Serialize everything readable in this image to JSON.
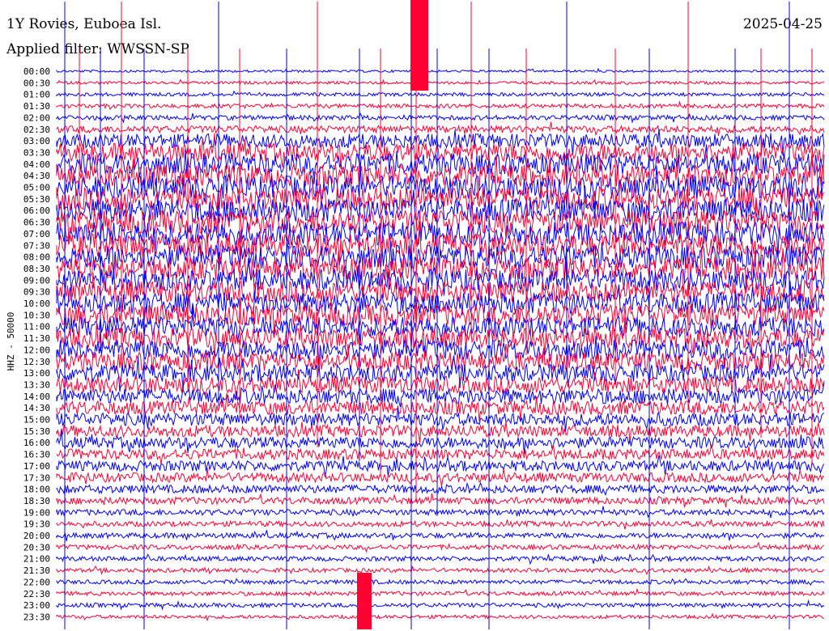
{
  "header": {
    "title": "1Y Rovies, Euboea Isl.",
    "date": "2025-04-25",
    "filter": "Applied filter: WWSSN-SP"
  },
  "chart_data": {
    "type": "line",
    "subtype": "helicorder",
    "ylabel": "HHZ - 50000",
    "colors": [
      "#0000ff",
      "#ff0033"
    ],
    "grid": false,
    "legend": "none",
    "rows": [
      {
        "label": "00:00",
        "amp": 0.2
      },
      {
        "label": "00:30",
        "amp": 0.25
      },
      {
        "label": "01:00",
        "amp": 0.3
      },
      {
        "label": "01:30",
        "amp": 0.35
      },
      {
        "label": "02:00",
        "amp": 0.4
      },
      {
        "label": "02:30",
        "amp": 0.6
      },
      {
        "label": "03:00",
        "amp": 1.2
      },
      {
        "label": "03:30",
        "amp": 1.6
      },
      {
        "label": "04:00",
        "amp": 1.8
      },
      {
        "label": "04:30",
        "amp": 1.9
      },
      {
        "label": "05:00",
        "amp": 2.0
      },
      {
        "label": "05:30",
        "amp": 2.0
      },
      {
        "label": "06:00",
        "amp": 2.0
      },
      {
        "label": "06:30",
        "amp": 2.0
      },
      {
        "label": "07:00",
        "amp": 2.0
      },
      {
        "label": "07:30",
        "amp": 2.0
      },
      {
        "label": "08:00",
        "amp": 2.0
      },
      {
        "label": "08:30",
        "amp": 2.0
      },
      {
        "label": "09:00",
        "amp": 1.9
      },
      {
        "label": "09:30",
        "amp": 1.8
      },
      {
        "label": "10:00",
        "amp": 1.8
      },
      {
        "label": "10:30",
        "amp": 1.8
      },
      {
        "label": "11:00",
        "amp": 1.7
      },
      {
        "label": "11:30",
        "amp": 1.7
      },
      {
        "label": "12:00",
        "amp": 1.7
      },
      {
        "label": "12:30",
        "amp": 1.6
      },
      {
        "label": "13:00",
        "amp": 1.5
      },
      {
        "label": "13:30",
        "amp": 1.4
      },
      {
        "label": "14:00",
        "amp": 1.3
      },
      {
        "label": "14:30",
        "amp": 1.2
      },
      {
        "label": "15:00",
        "amp": 1.1
      },
      {
        "label": "15:30",
        "amp": 1.0
      },
      {
        "label": "16:00",
        "amp": 1.0
      },
      {
        "label": "16:30",
        "amp": 0.9
      },
      {
        "label": "17:00",
        "amp": 0.9
      },
      {
        "label": "17:30",
        "amp": 0.8
      },
      {
        "label": "18:00",
        "amp": 0.7
      },
      {
        "label": "18:30",
        "amp": 0.6
      },
      {
        "label": "19:00",
        "amp": 0.5
      },
      {
        "label": "19:30",
        "amp": 0.45
      },
      {
        "label": "20:00",
        "amp": 0.45
      },
      {
        "label": "20:30",
        "amp": 0.4
      },
      {
        "label": "21:00",
        "amp": 0.4
      },
      {
        "label": "21:30",
        "amp": 0.35
      },
      {
        "label": "22:00",
        "amp": 0.35
      },
      {
        "label": "22:30",
        "amp": 0.35
      },
      {
        "label": "23:00",
        "amp": 0.35
      },
      {
        "label": "23:30",
        "amp": 0.3
      }
    ]
  }
}
